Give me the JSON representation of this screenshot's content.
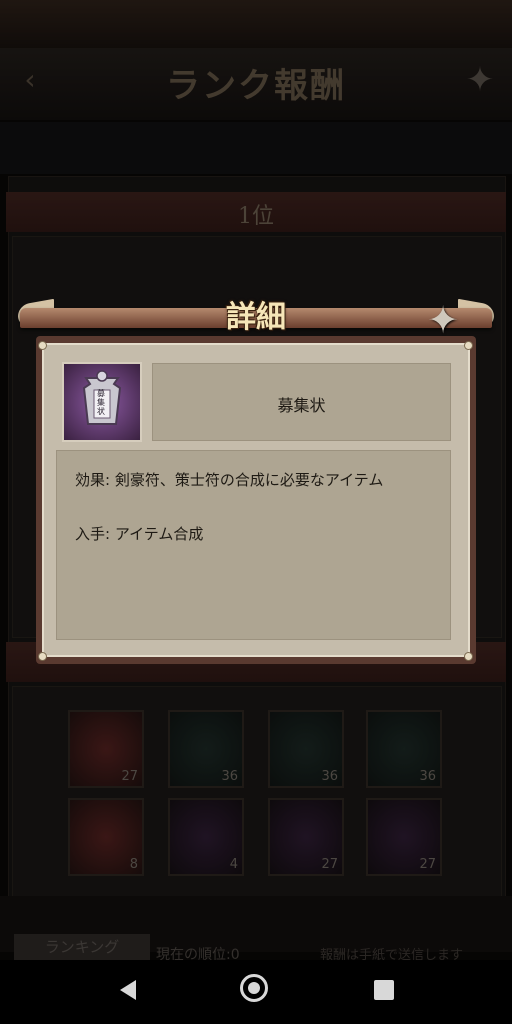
{
  "header": {
    "title": "ランク報酬"
  },
  "rank_section": {
    "label": "1位"
  },
  "reward_items": [
    {
      "name": "gift-box-red",
      "count": "27"
    },
    {
      "name": "armor-piece",
      "count": "36"
    },
    {
      "name": "scroll-bundle",
      "count": "36"
    },
    {
      "name": "kunai",
      "count": "36"
    },
    {
      "name": "banner-red",
      "count": "8"
    },
    {
      "name": "banner-bu",
      "count": "4"
    },
    {
      "name": "treasure-chest",
      "count": "27"
    },
    {
      "name": "treasure-chest-2",
      "count": "27"
    }
  ],
  "footer": {
    "ranking_button": "ランキング",
    "current_rank": "現在の順位:0",
    "note": "報酬は手紙で送信します"
  },
  "dialog": {
    "title": "詳細",
    "item_name": "募集状",
    "item_icon_glyph": "募集状",
    "effect_text": "効果: 剣豪符、策士符の合成に必要なアイテム",
    "source_text": "入手: アイテム合成"
  },
  "colors": {
    "dialog_bg": "#c5bcab",
    "dialog_frame": "#5a3a30",
    "text": "#1e1a14"
  }
}
